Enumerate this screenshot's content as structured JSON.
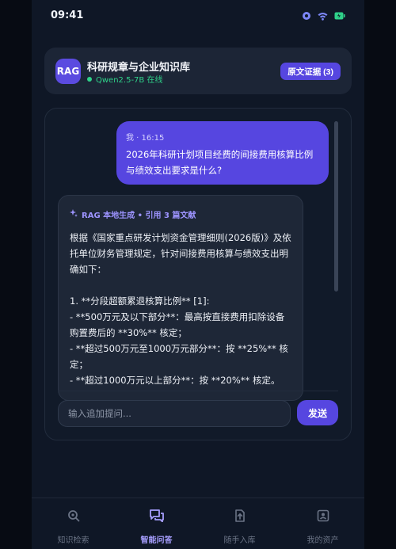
{
  "status_bar": {
    "time": "09:41"
  },
  "header": {
    "badge": "RAG",
    "title": "科研规章与企业知识库",
    "status": "Qwen2.5-7B 在线",
    "evidence_button": "原文证据 (3)"
  },
  "chat": {
    "user_message": {
      "meta": "我 · 16:15",
      "text": "2026年科研计划项目经费的间接费用核算比例与绩效支出要求是什么?"
    },
    "ai_message": {
      "meta": "RAG 本地生成 • 引用 3 篇文献",
      "text": "根据《国家重点研发计划资金管理细则(2026版)》及依托单位财务管理规定，针对间接费用核算与绩效支出明确如下：\n\n1. **分段超额累退核算比例** [1]:\n- **500万元及以下部分**：最高按直接费用扣除设备购置费后的 **30%** 核定；\n- **超过500万元至1000万元部分**：按 **25%** 核定；\n- **超过1000万元以上部分**：按 **20%** 核定。"
    },
    "input_placeholder": "输入追加提问...",
    "send_label": "发送"
  },
  "nav": {
    "items": [
      {
        "label": "知识检索",
        "icon": "search-icon",
        "active": false
      },
      {
        "label": "智能问答",
        "icon": "chat-icon",
        "active": true
      },
      {
        "label": "随手入库",
        "icon": "upload-icon",
        "active": false
      },
      {
        "label": "我的资产",
        "icon": "profile-card-icon",
        "active": false
      }
    ]
  },
  "colors": {
    "accent": "#5646e0",
    "online": "#2fd189",
    "active_nav": "#a79fff"
  }
}
